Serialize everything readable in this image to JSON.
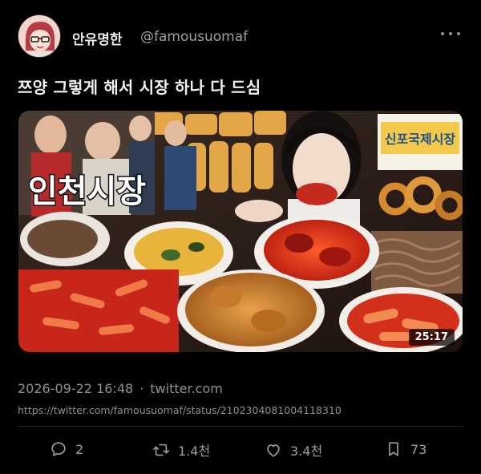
{
  "tweet": {
    "author": {
      "display_name": "안유명한",
      "handle": "@famousuomaf"
    },
    "text": "쯔양 그렇게 해서 시장 하나 다 드심",
    "media": {
      "overlay_title": "인천시장",
      "sign_text": "신포국제시장",
      "duration": "25:17"
    },
    "timestamp": "2026-09-22 16:48",
    "separator": "·",
    "source": "twitter.com",
    "url": "https://twitter.com/famousuomaf/status/2102304081004118310",
    "actions": {
      "replies": "2",
      "retweets": "1.4천",
      "likes": "3.4천",
      "bookmarks": "73"
    },
    "icons": [
      "more-icon",
      "reply-icon",
      "retweet-icon",
      "like-icon",
      "bookmark-icon"
    ]
  }
}
